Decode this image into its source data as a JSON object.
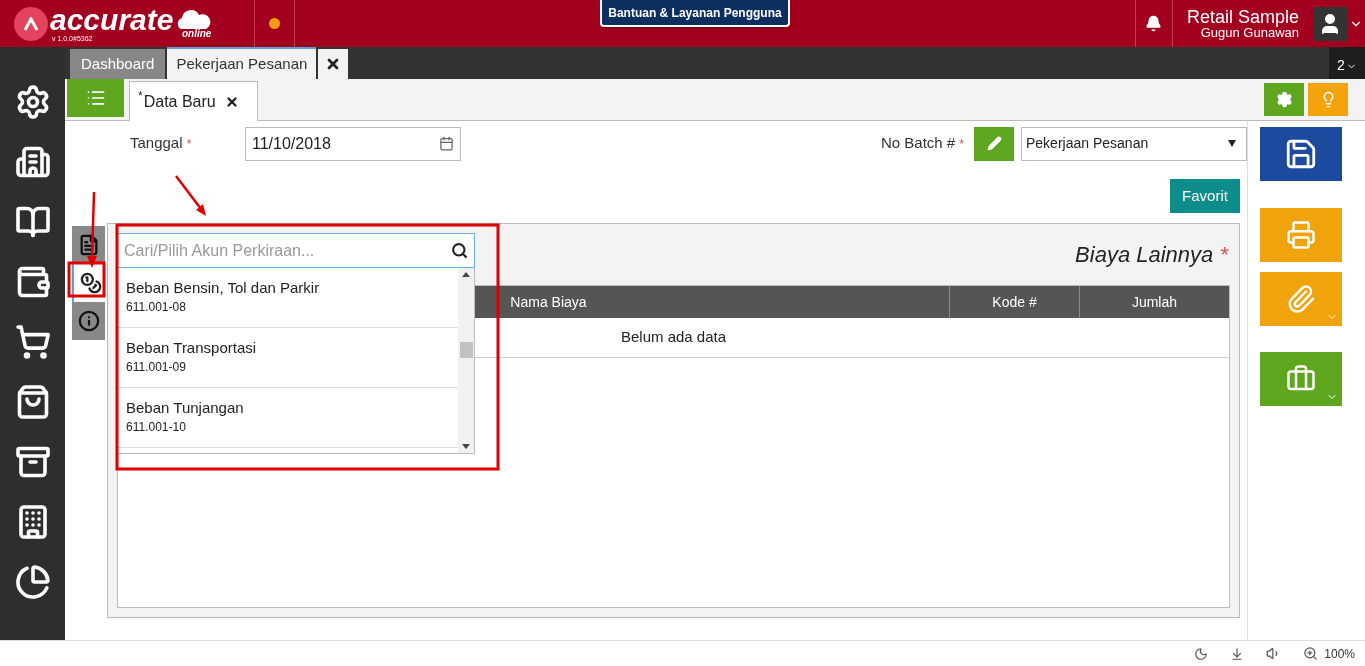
{
  "header": {
    "logo": "accurate",
    "logo_sub": "online",
    "version": "v 1.0.0#5362",
    "help_button": "Bantuan & Layanan Pengguna",
    "company": "Retail Sample",
    "user": "Gugun Gunawan"
  },
  "sidebar": {
    "items": [
      {
        "kind": "settings"
      },
      {
        "kind": "building"
      },
      {
        "kind": "book"
      },
      {
        "kind": "wallet"
      },
      {
        "kind": "cart"
      },
      {
        "kind": "bag"
      },
      {
        "kind": "archive"
      },
      {
        "kind": "buildings"
      },
      {
        "kind": "chart"
      }
    ]
  },
  "tabs": [
    {
      "label": "Dashboard",
      "selected": false
    },
    {
      "label": "Pekerjaan Pesanan",
      "selected": true
    }
  ],
  "tab_count": "2",
  "subtab": {
    "label": "Data Baru",
    "mark": "*"
  },
  "form": {
    "date": {
      "label": "Tanggal",
      "mark": "*",
      "value": "11/10/2018"
    },
    "batch": {
      "label": "No Batch #",
      "mark": "*",
      "value": "Pekerjaan Pesanan"
    },
    "favorite_button": "Favorit"
  },
  "side_tabs": [
    {
      "kind": "document",
      "selected": false
    },
    {
      "kind": "money",
      "selected": true
    },
    {
      "kind": "info",
      "selected": false
    }
  ],
  "panel": {
    "title": "Biaya Lainnya",
    "mark": "*",
    "columns": [
      "Nama Biaya",
      "Kode #",
      "Jumlah"
    ],
    "empty_text": "Belum ada data"
  },
  "dropdown": {
    "placeholder": "Cari/Pilih Akun Perkiraan...",
    "items": [
      {
        "name": "Beban Bensin, Tol dan Parkir",
        "code": "611.001-08"
      },
      {
        "name": "Beban Transportasi",
        "code": "611.001-09"
      },
      {
        "name": "Beban Tunjangan",
        "code": "611.001-10"
      }
    ]
  },
  "status_bar": {
    "zoom": "100%"
  }
}
